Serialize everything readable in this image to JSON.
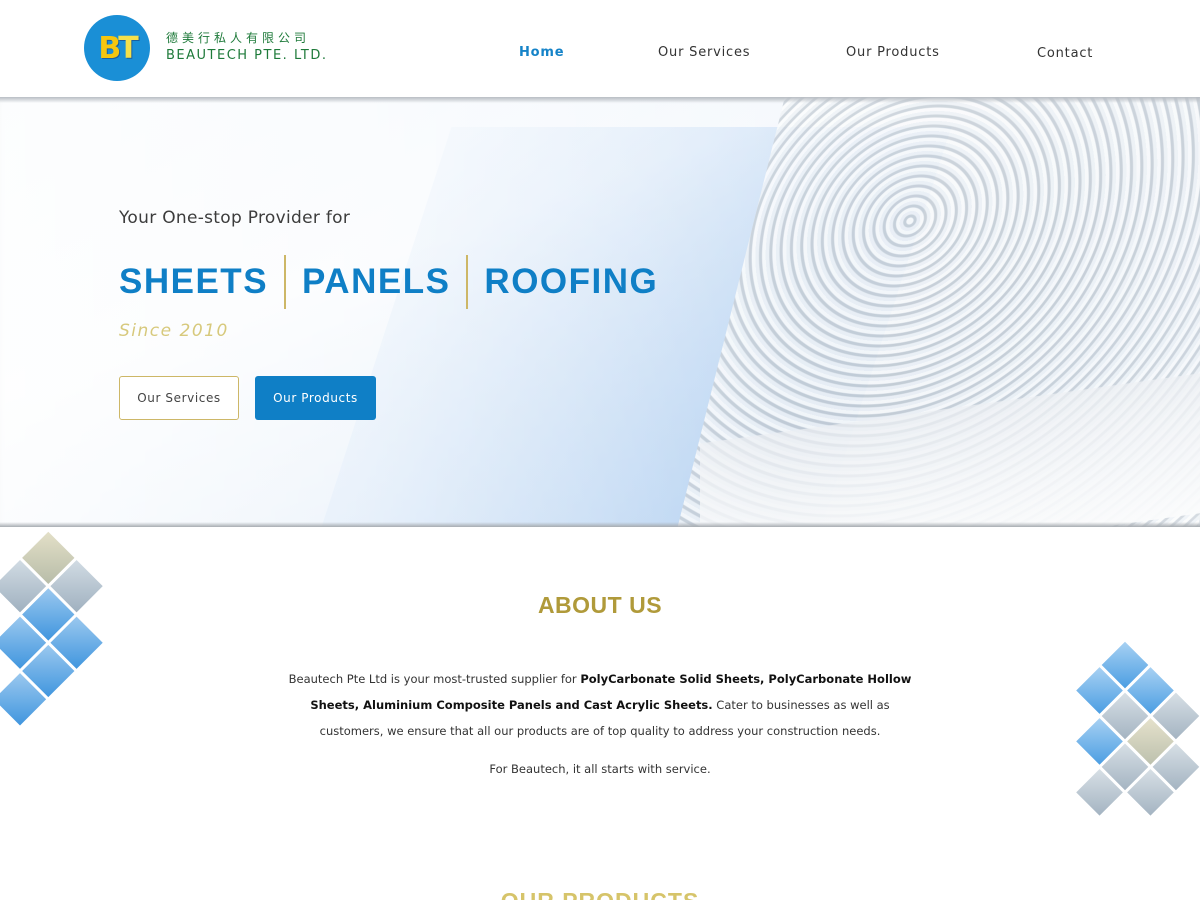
{
  "logo": {
    "mark_b": "B",
    "mark_t": "T",
    "chinese_name": "德美行私人有限公司",
    "english_name": "BEAUTECH PTE. LTD."
  },
  "nav": {
    "items": [
      {
        "label": "Home",
        "active": true
      },
      {
        "label": "Our Services",
        "active": false
      },
      {
        "label": "Our Products",
        "active": false
      },
      {
        "label": "Contact",
        "active": false
      }
    ]
  },
  "hero": {
    "tagline": "Your One-stop Provider for",
    "headline": [
      "SHEETS",
      "PANELS",
      "ROOFING"
    ],
    "since": "Since 2010",
    "buttons": {
      "services": "Our Services",
      "products": "Our Products"
    }
  },
  "about": {
    "title": "ABOUT US",
    "p1_a": "Beautech Pte Ltd is your most-trusted supplier for ",
    "p1_bold": "PolyCarbonate Solid Sheets, PolyCarbonate Hollow Sheets, Aluminium Composite Panels and Cast Acrylic Sheets.",
    "p1_b": " Cater to businesses as well as customers, we ensure that all our products are of top quality to address your construction needs.",
    "p2": "For Beautech, it all starts with service."
  },
  "next_section": {
    "title": "OUR PRODUCTS"
  },
  "colors": {
    "brand_blue": "#0f7fc6",
    "gold": "#b09a3a",
    "logo_green": "#1e7a3a"
  }
}
